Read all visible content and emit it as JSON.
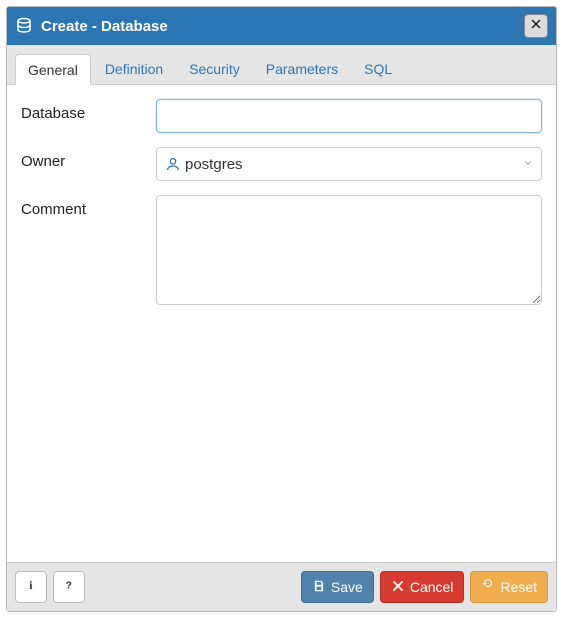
{
  "window": {
    "title": "Create - Database"
  },
  "tabs": [
    {
      "label": "General",
      "active": true
    },
    {
      "label": "Definition",
      "active": false
    },
    {
      "label": "Security",
      "active": false
    },
    {
      "label": "Parameters",
      "active": false
    },
    {
      "label": "SQL",
      "active": false
    }
  ],
  "form": {
    "database": {
      "label": "Database",
      "value": ""
    },
    "owner": {
      "label": "Owner",
      "value": "postgres"
    },
    "comment": {
      "label": "Comment",
      "value": ""
    }
  },
  "footer": {
    "save": "Save",
    "cancel": "Cancel",
    "reset": "Reset"
  }
}
